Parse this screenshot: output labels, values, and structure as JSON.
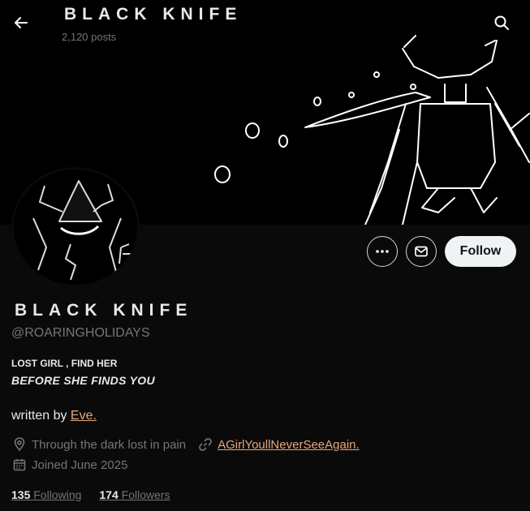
{
  "topbar": {
    "title": "BLACK KNIFE",
    "posts": "2,120 posts",
    "back_icon": "arrow-left-icon",
    "search_icon": "search-icon"
  },
  "profile": {
    "name": "BLACK KNIFE",
    "handle": "@ROARINGHOLIDAYS",
    "bio_line1": "LOST GIRL , FIND HER",
    "bio_line2": "BEFORE SHE FINDS YOU",
    "written_prefix": "written by",
    "written_link": "Eve.",
    "location": "Through the dark lost in pain",
    "website": "AGirlYoullNeverSeeAgain.",
    "joined": "Joined June 2025",
    "following_count": "135",
    "following_label": "Following",
    "followers_count": "174",
    "followers_label": "Followers"
  },
  "actions": {
    "more_icon": "more-icon",
    "message_icon": "mail-icon",
    "follow_label": "Follow"
  },
  "colors": {
    "background": "#0a0a0a",
    "banner": "#000000",
    "link_accent": "#e8a87c",
    "muted_text": "#71767b",
    "follow_button": "#eff3f4"
  }
}
